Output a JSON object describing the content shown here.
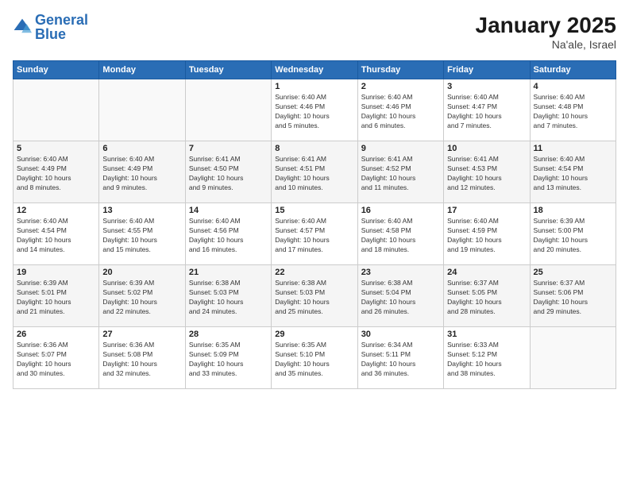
{
  "logo": {
    "text_general": "General",
    "text_blue": "Blue"
  },
  "header": {
    "title": "January 2025",
    "subtitle": "Na'ale, Israel"
  },
  "weekdays": [
    "Sunday",
    "Monday",
    "Tuesday",
    "Wednesday",
    "Thursday",
    "Friday",
    "Saturday"
  ],
  "weeks": [
    [
      {
        "day": "",
        "info": ""
      },
      {
        "day": "",
        "info": ""
      },
      {
        "day": "",
        "info": ""
      },
      {
        "day": "1",
        "info": "Sunrise: 6:40 AM\nSunset: 4:46 PM\nDaylight: 10 hours\nand 5 minutes."
      },
      {
        "day": "2",
        "info": "Sunrise: 6:40 AM\nSunset: 4:46 PM\nDaylight: 10 hours\nand 6 minutes."
      },
      {
        "day": "3",
        "info": "Sunrise: 6:40 AM\nSunset: 4:47 PM\nDaylight: 10 hours\nand 7 minutes."
      },
      {
        "day": "4",
        "info": "Sunrise: 6:40 AM\nSunset: 4:48 PM\nDaylight: 10 hours\nand 7 minutes."
      }
    ],
    [
      {
        "day": "5",
        "info": "Sunrise: 6:40 AM\nSunset: 4:49 PM\nDaylight: 10 hours\nand 8 minutes."
      },
      {
        "day": "6",
        "info": "Sunrise: 6:40 AM\nSunset: 4:49 PM\nDaylight: 10 hours\nand 9 minutes."
      },
      {
        "day": "7",
        "info": "Sunrise: 6:41 AM\nSunset: 4:50 PM\nDaylight: 10 hours\nand 9 minutes."
      },
      {
        "day": "8",
        "info": "Sunrise: 6:41 AM\nSunset: 4:51 PM\nDaylight: 10 hours\nand 10 minutes."
      },
      {
        "day": "9",
        "info": "Sunrise: 6:41 AM\nSunset: 4:52 PM\nDaylight: 10 hours\nand 11 minutes."
      },
      {
        "day": "10",
        "info": "Sunrise: 6:41 AM\nSunset: 4:53 PM\nDaylight: 10 hours\nand 12 minutes."
      },
      {
        "day": "11",
        "info": "Sunrise: 6:40 AM\nSunset: 4:54 PM\nDaylight: 10 hours\nand 13 minutes."
      }
    ],
    [
      {
        "day": "12",
        "info": "Sunrise: 6:40 AM\nSunset: 4:54 PM\nDaylight: 10 hours\nand 14 minutes."
      },
      {
        "day": "13",
        "info": "Sunrise: 6:40 AM\nSunset: 4:55 PM\nDaylight: 10 hours\nand 15 minutes."
      },
      {
        "day": "14",
        "info": "Sunrise: 6:40 AM\nSunset: 4:56 PM\nDaylight: 10 hours\nand 16 minutes."
      },
      {
        "day": "15",
        "info": "Sunrise: 6:40 AM\nSunset: 4:57 PM\nDaylight: 10 hours\nand 17 minutes."
      },
      {
        "day": "16",
        "info": "Sunrise: 6:40 AM\nSunset: 4:58 PM\nDaylight: 10 hours\nand 18 minutes."
      },
      {
        "day": "17",
        "info": "Sunrise: 6:40 AM\nSunset: 4:59 PM\nDaylight: 10 hours\nand 19 minutes."
      },
      {
        "day": "18",
        "info": "Sunrise: 6:39 AM\nSunset: 5:00 PM\nDaylight: 10 hours\nand 20 minutes."
      }
    ],
    [
      {
        "day": "19",
        "info": "Sunrise: 6:39 AM\nSunset: 5:01 PM\nDaylight: 10 hours\nand 21 minutes."
      },
      {
        "day": "20",
        "info": "Sunrise: 6:39 AM\nSunset: 5:02 PM\nDaylight: 10 hours\nand 22 minutes."
      },
      {
        "day": "21",
        "info": "Sunrise: 6:38 AM\nSunset: 5:03 PM\nDaylight: 10 hours\nand 24 minutes."
      },
      {
        "day": "22",
        "info": "Sunrise: 6:38 AM\nSunset: 5:03 PM\nDaylight: 10 hours\nand 25 minutes."
      },
      {
        "day": "23",
        "info": "Sunrise: 6:38 AM\nSunset: 5:04 PM\nDaylight: 10 hours\nand 26 minutes."
      },
      {
        "day": "24",
        "info": "Sunrise: 6:37 AM\nSunset: 5:05 PM\nDaylight: 10 hours\nand 28 minutes."
      },
      {
        "day": "25",
        "info": "Sunrise: 6:37 AM\nSunset: 5:06 PM\nDaylight: 10 hours\nand 29 minutes."
      }
    ],
    [
      {
        "day": "26",
        "info": "Sunrise: 6:36 AM\nSunset: 5:07 PM\nDaylight: 10 hours\nand 30 minutes."
      },
      {
        "day": "27",
        "info": "Sunrise: 6:36 AM\nSunset: 5:08 PM\nDaylight: 10 hours\nand 32 minutes."
      },
      {
        "day": "28",
        "info": "Sunrise: 6:35 AM\nSunset: 5:09 PM\nDaylight: 10 hours\nand 33 minutes."
      },
      {
        "day": "29",
        "info": "Sunrise: 6:35 AM\nSunset: 5:10 PM\nDaylight: 10 hours\nand 35 minutes."
      },
      {
        "day": "30",
        "info": "Sunrise: 6:34 AM\nSunset: 5:11 PM\nDaylight: 10 hours\nand 36 minutes."
      },
      {
        "day": "31",
        "info": "Sunrise: 6:33 AM\nSunset: 5:12 PM\nDaylight: 10 hours\nand 38 minutes."
      },
      {
        "day": "",
        "info": ""
      }
    ]
  ]
}
